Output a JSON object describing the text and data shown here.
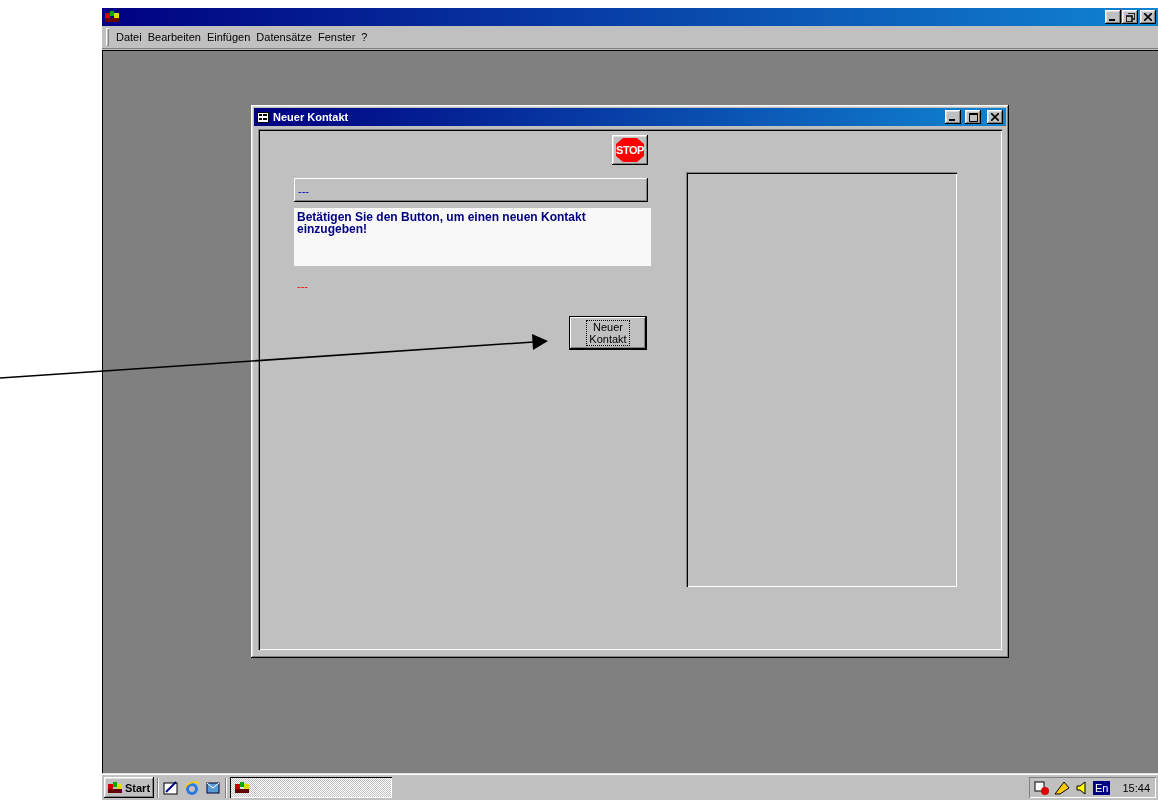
{
  "menu": [
    {
      "label": "Datei"
    },
    {
      "label": "Bearbeiten"
    },
    {
      "label": "Einfügen"
    },
    {
      "label": "Datensätze"
    },
    {
      "label": "Fenster"
    },
    {
      "label": "?"
    }
  ],
  "form_window": {
    "title": "Neuer Kontakt",
    "stop_button": "STOP",
    "status_field": "---",
    "message": "Betätigen Sie den Button, um einen neuen Kontakt einzugeben!",
    "error_text": "---",
    "new_contact_button": "Neuer Kontakt"
  },
  "taskbar": {
    "start": "Start",
    "language": "En",
    "clock": "15:44"
  }
}
